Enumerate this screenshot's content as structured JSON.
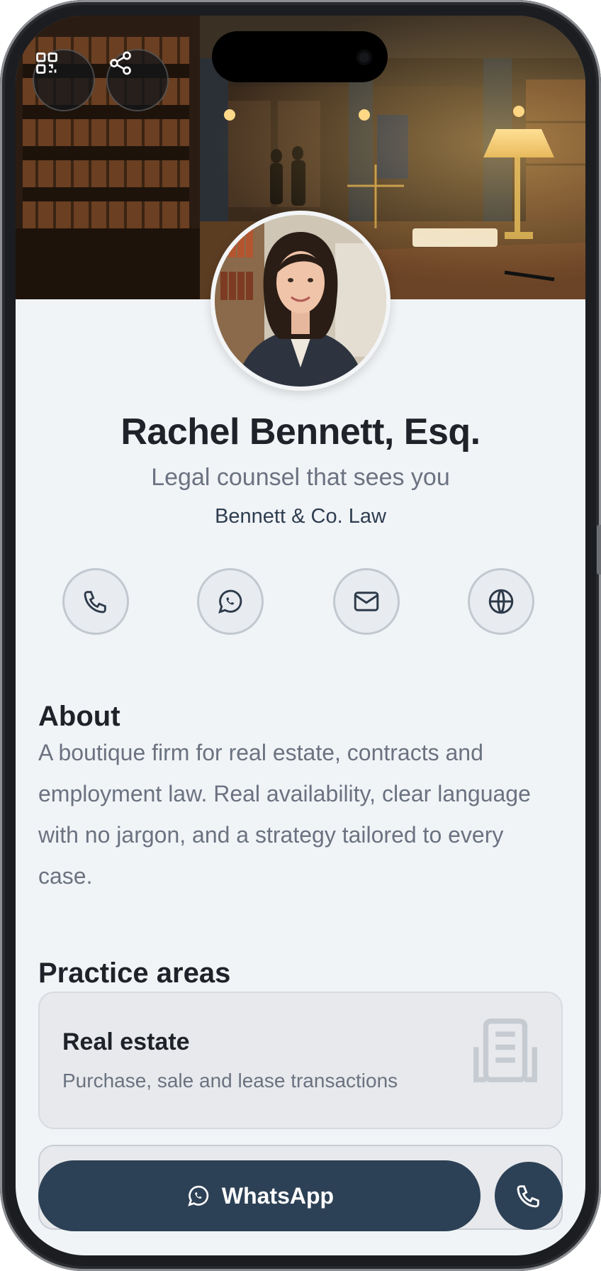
{
  "profile": {
    "name": "Rachel Bennett, Esq.",
    "tagline": "Legal counsel that sees you",
    "firm": "Bennett & Co. Law"
  },
  "header": {
    "qr_icon": "qr-code-icon",
    "share_icon": "share-icon"
  },
  "contacts": [
    {
      "name": "phone",
      "icon": "phone-icon"
    },
    {
      "name": "whatsapp",
      "icon": "whatsapp-icon"
    },
    {
      "name": "email",
      "icon": "mail-icon"
    },
    {
      "name": "website",
      "icon": "globe-icon"
    }
  ],
  "about": {
    "heading": "About",
    "text": "A boutique firm for real estate, contracts and employment law. Real availability, clear language with no jargon, and a strategy tailored to every case."
  },
  "practice": {
    "heading": "Practice areas",
    "items": [
      {
        "title": "Real estate",
        "description": "Purchase, sale and lease transactions",
        "icon": "building-icon"
      }
    ]
  },
  "actions": {
    "whatsapp_label": "WhatsApp",
    "call_icon": "phone-icon"
  },
  "colors": {
    "primary": "#2d4156",
    "background": "#f1f4f7",
    "text": "#1f2329",
    "muted": "#6b7280"
  }
}
